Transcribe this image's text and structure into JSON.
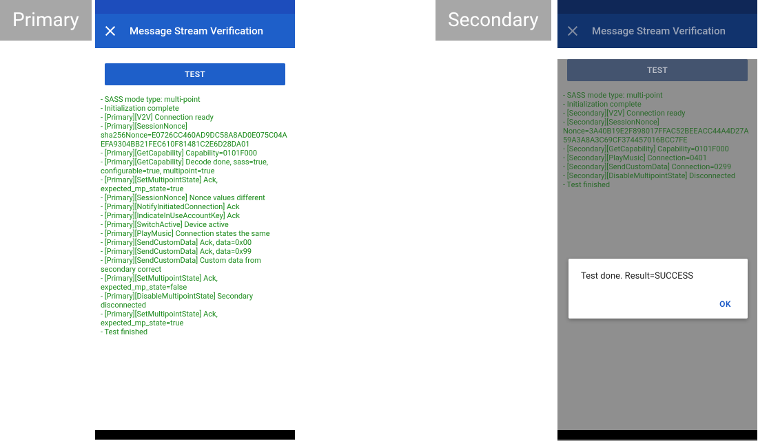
{
  "labels": {
    "primary_tag": "Primary",
    "secondary_tag": "Secondary",
    "appbar_title": "Message Stream Verification",
    "test_button": "TEST",
    "dialog_ok": "OK"
  },
  "primary_log": [
    " - SASS mode type: multi-point",
    " - Initialization complete",
    " - [Primary][V2V] Connection ready",
    " - [Primary][SessionNonce] sha256Nonce=E0726CC460AD9DC58A8AD0E075C04AEFA9304BB21FEC610F81481C2E6D28DA01",
    " - [Primary][GetCapability] Capability=0101F000",
    " - [Primary][GetCapability] Decode done, sass=true, configurable=true, multipoint=true",
    " - [Primary][SetMultipointState] Ack, expected_mp_state=true",
    " - [Primary][SessionNonce] Nonce values different",
    " - [Primary][NotifyInitiatedConnection] Ack",
    " - [Primary][IndicateInUseAccountKey] Ack",
    " - [Primary][SwitchActive] Device active",
    " - [Primary][PlayMusic] Connection states the same",
    " - [Primary][SendCustomData] Ack, data=0x00",
    " - [Primary][SendCustomData] Ack, data=0x99",
    " - [Primary][SendCustomData] Custom data from secondary correct",
    " - [Primary][SetMultipointState] Ack, expected_mp_state=false",
    " - [Primary][DisableMultipointState] Secondary disconnected",
    " - [Primary][SetMultipointState] Ack, expected_mp_state=true",
    " - Test finished"
  ],
  "secondary_log": [
    " - SASS mode type: multi-point",
    " - Initialization complete",
    " - [Secondary][V2V] Connection ready",
    " - [Secondary][SessionNonce] Nonce=3A40B19E2F898017FFAC52BEEACC44A4D27A59A3A8A3C69CF374457016BCC7FE",
    " - [Secondary][GetCapability] Capability=0101F000",
    " - [Secondary][PlayMusic] Connection=0401",
    " - [Secondary][SendCustomData] Connection=0299",
    " - [Secondary][DisableMultipointState] Disconnected",
    " - Test finished"
  ],
  "dialog": {
    "message": "Test done. Result=SUCCESS"
  }
}
